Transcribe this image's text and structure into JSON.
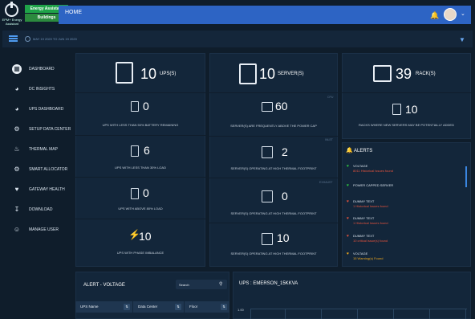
{
  "brand": {
    "logo_text": "EPM+ Energy Assistant",
    "line1": "Energy Assistant",
    "line2": "Buildings"
  },
  "header": {
    "title": "HOME"
  },
  "subbar": {
    "date_range": "MAY 19 2020 TO JUN 19 2020"
  },
  "sidebar": {
    "items": [
      {
        "label": "DASHBOARD",
        "icon": "dashboard-icon",
        "active": true
      },
      {
        "label": "DC INSIGHTS",
        "icon": "pie-chart-icon"
      },
      {
        "label": "UPS DASHBOARD",
        "icon": "pie-chart-icon"
      },
      {
        "label": "SETUP DATA CENTER",
        "icon": "network-icon"
      },
      {
        "label": "THERMAL MAP",
        "icon": "thermal-icon"
      },
      {
        "label": "SMART ALLOCATOR",
        "icon": "gear-icon"
      },
      {
        "label": "GATEWAY HEALTH",
        "icon": "heartbeat-icon"
      },
      {
        "label": "DOWNLOAD",
        "icon": "download-icon"
      },
      {
        "label": "MANAGE USER",
        "icon": "user-icon"
      }
    ]
  },
  "ups": {
    "total": "10",
    "total_unit": "UPS(S)",
    "low_battery_value": "0",
    "low_battery_label": "UPS WITH LESS THAN 50% BATTERY REMAINING",
    "low_load_value": "6",
    "low_load_label": "UPS WITH LESS THAN 30% LOAD",
    "high_load_value": "0",
    "high_load_label": "UPS WITH ABOVE 80% LOAD",
    "imbalance_value": "10",
    "imbalance_label": "UPS WITH PHASE IMBALANCE"
  },
  "servers": {
    "total": "10",
    "total_unit": "SERVER(S)",
    "above_cap_value": "60",
    "above_cap_label": "SERVER(S) ARE FREQUENTLY ABOVE THE POWER CAP",
    "above_cap_tag": "CPU",
    "thermal1_value": "2",
    "thermal1_label": "SERVER(S) OPERATING AT HIGH  THERMAL FOOTPRINT",
    "thermal1_tag": "INLET",
    "thermal2_value": "0",
    "thermal2_label": "SERVER(S) OPERATING AT HIGH  THERMAL FOOTPRINT",
    "thermal2_tag": "EXHAUST",
    "thermal3_value": "10",
    "thermal3_label": "SERVER(S) OPERATING AT HIGH THERMAL FOOTPRINT"
  },
  "racks": {
    "total": "39",
    "total_unit": "RACK(S)",
    "new_servers_value": "10",
    "new_servers_label": "RACKS WHERE NEW SERVERS MAY BE POTENTIALLY ADDED"
  },
  "alerts": {
    "title": "ALERTS",
    "items": [
      {
        "name": "VOLTAGE",
        "detail": "8011 Historical Issues found",
        "color": "#2ecc40",
        "detail_color": "#e5533d"
      },
      {
        "name": "POWER CAPPED SERVER",
        "detail": "",
        "color": "#2ecc40",
        "detail_color": "#e5533d"
      },
      {
        "name": "DUMMY TEXT",
        "detail": "1 Historical Issues found",
        "color": "#e5533d",
        "detail_color": "#e5533d"
      },
      {
        "name": "DUMMY TEXT",
        "detail": "1 Historical Issues found",
        "color": "#e5533d",
        "detail_color": "#e5533d"
      },
      {
        "name": "DUMMY TEXT",
        "detail": "10 critical issue(s) found",
        "color": "#e5533d",
        "detail_color": "#e5533d"
      },
      {
        "name": "VOLTAGE",
        "detail": "15 Warning(s) Found",
        "color": "#f0a91d",
        "detail_color": "#f0a91d"
      }
    ]
  },
  "alert_voltage": {
    "title": "ALERT - VOLTAGE",
    "search_placeholder": "Search",
    "columns": [
      "UPS Name",
      "Data Center",
      "Floor"
    ]
  },
  "ups_chart": {
    "title": "UPS : EMERSON_15KKVA",
    "y_tick": "1.00"
  }
}
